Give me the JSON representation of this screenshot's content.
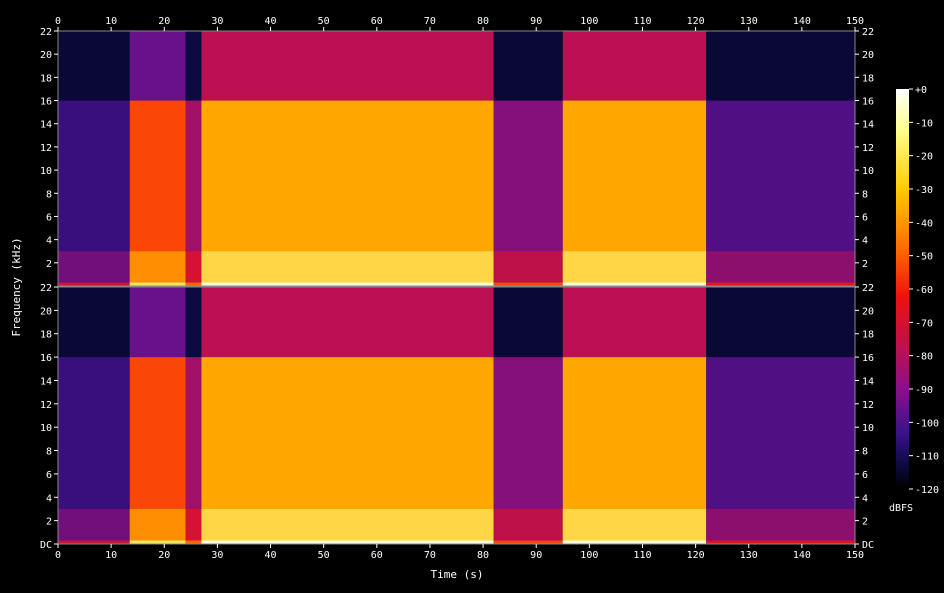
{
  "chart_data": {
    "type": "heatmap",
    "xlabel": "Time (s)",
    "ylabel": "Frequency (kHz)",
    "xlim": [
      0,
      150
    ],
    "x_ticks": [
      0,
      10,
      20,
      30,
      40,
      50,
      60,
      70,
      80,
      90,
      100,
      110,
      120,
      130,
      140,
      150
    ],
    "channels": [
      {
        "ylim": [
          0,
          22
        ],
        "y_ticks": [
          2,
          4,
          6,
          8,
          10,
          12,
          14,
          16,
          18,
          20,
          22
        ],
        "y_tick_labels": [
          "2",
          "4",
          "6",
          "8",
          "10",
          "12",
          "14",
          "16",
          "18",
          "20",
          "22"
        ]
      },
      {
        "ylim": [
          0,
          22
        ],
        "y_ticks": [
          0,
          2,
          4,
          6,
          8,
          10,
          12,
          14,
          16,
          18,
          20,
          22
        ],
        "y_tick_labels": [
          "DC",
          "2",
          "4",
          "6",
          "8",
          "10",
          "12",
          "14",
          "16",
          "18",
          "20",
          "22"
        ]
      }
    ],
    "colorbar": {
      "label": "dBFS",
      "range": [
        -120,
        0
      ],
      "ticks": [
        0,
        -10,
        -20,
        -30,
        -40,
        -50,
        -60,
        -70,
        -80,
        -90,
        -100,
        -110,
        -120
      ],
      "tick_labels": [
        "+0",
        "-10",
        "-20",
        "-30",
        "-40",
        "-50",
        "-60",
        "-70",
        "-80",
        "-90",
        "-100",
        "-110",
        "-120"
      ]
    },
    "segments": [
      {
        "start": 0,
        "end": 13.5,
        "level_dB": -95,
        "cutoff_kHz": 16
      },
      {
        "start": 13.5,
        "end": 24,
        "level_dB": -50,
        "cutoff_kHz": 16
      },
      {
        "start": 24,
        "end": 27,
        "level_dB": -75,
        "cutoff_kHz": 16
      },
      {
        "start": 27,
        "end": 82,
        "level_dB": -35,
        "cutoff_kHz": 16
      },
      {
        "start": 82,
        "end": 95,
        "level_dB": -80,
        "cutoff_kHz": 16
      },
      {
        "start": 95,
        "end": 122,
        "level_dB": -35,
        "cutoff_kHz": 16
      },
      {
        "start": 122,
        "end": 150,
        "level_dB": -90,
        "cutoff_kHz": 16
      }
    ]
  }
}
